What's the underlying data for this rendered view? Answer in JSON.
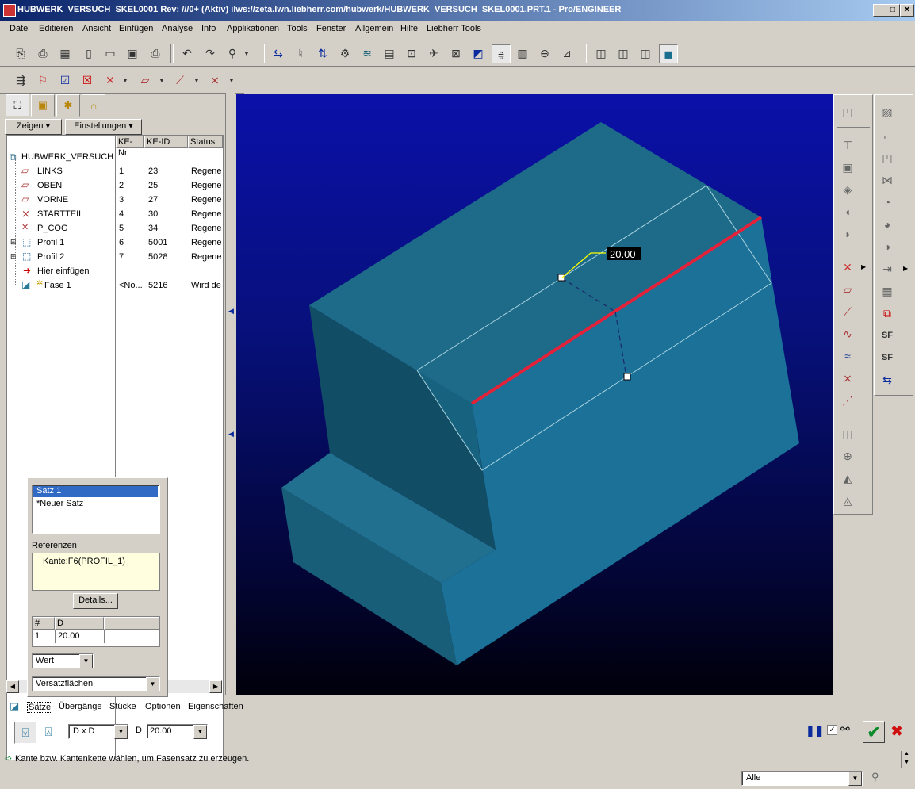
{
  "window": {
    "title": "HUBWERK_VERSUCH_SKEL0001 Rev: ///0+ (Aktiv) ilws://zeta.lwn.liebherr.com/hubwerk/HUBWERK_VERSUCH_SKEL0001.PRT.1 - Pro/ENGINEER",
    "minimize": "_",
    "maximize": "□",
    "close": "✕"
  },
  "menu": [
    "Datei",
    "Editieren",
    "Ansicht",
    "Einfügen",
    "Analyse",
    "Info",
    "Applikationen",
    "Tools",
    "Fenster",
    "Allgemein",
    "Hilfe",
    "Liebherr Tools"
  ],
  "left_panel": {
    "show_button": "Zeigen",
    "settings_button": "Einstellungen",
    "columns": [
      "KE-Nr.",
      "KE-ID",
      "Status"
    ],
    "root": "HUBWERK_VERSUCH",
    "rows": [
      {
        "name": "LINKS",
        "nr": "1",
        "id": "23",
        "status": "Regene"
      },
      {
        "name": "OBEN",
        "nr": "2",
        "id": "25",
        "status": "Regene"
      },
      {
        "name": "VORNE",
        "nr": "3",
        "id": "27",
        "status": "Regene"
      },
      {
        "name": "STARTTEIL",
        "nr": "4",
        "id": "30",
        "status": "Regene"
      },
      {
        "name": "P_COG",
        "nr": "5",
        "id": "34",
        "status": "Regene"
      },
      {
        "name": "Profil 1",
        "nr": "6",
        "id": "5001",
        "status": "Regene"
      },
      {
        "name": "Profil 2",
        "nr": "7",
        "id": "5028",
        "status": "Regene"
      },
      {
        "name": "Hier einfügen",
        "nr": "",
        "id": "",
        "status": ""
      },
      {
        "name": "Fase 1",
        "nr": "<No...",
        "id": "5216",
        "status": "Wird de"
      }
    ]
  },
  "sets_panel": {
    "sets": [
      "Satz 1",
      "*Neuer Satz"
    ],
    "references_label": "Referenzen",
    "reference": "Kante:F6(PROFIL_1)",
    "details_button": "Details...",
    "table_headers": [
      "#",
      "D"
    ],
    "table_rows": [
      {
        "n": "1",
        "d": "20.00"
      }
    ],
    "value_mode": "Wert",
    "offset_mode": "Versatzflächen"
  },
  "viewport": {
    "dimension_label": "20.00"
  },
  "dash_tabs": [
    "Sätze",
    "Übergänge",
    "Stücke",
    "Optionen",
    "Eigenschaften"
  ],
  "dashboard": {
    "scheme": "D x D",
    "d_label": "D",
    "d_value": "20.00"
  },
  "status": {
    "message": "Kante bzw. Kantenkette wählen, um Fasensatz zu erzeugen.",
    "filter": "Alle"
  },
  "colors": {
    "background_top": "#0b10a8",
    "model": "#1a6f8e",
    "selected_edge": "#e5213a"
  }
}
